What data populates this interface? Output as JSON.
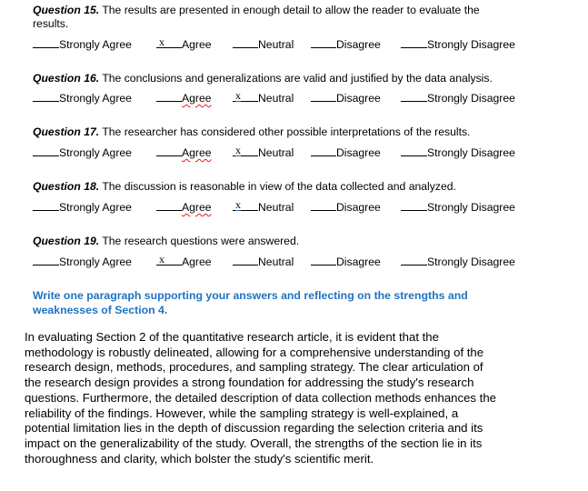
{
  "questions": [
    {
      "number": "Question 15.",
      "text_line1": " The results are presented in enough detail to allow the reader to evaluate the",
      "text_line2": "results.",
      "selected": "Agree",
      "options": [
        {
          "label": "Strongly Agree",
          "mark": "",
          "spell_flag": false
        },
        {
          "label": "Agree",
          "mark": "x",
          "spell_flag": false
        },
        {
          "label": "Neutral",
          "mark": "",
          "spell_flag": false
        },
        {
          "label": "Disagree",
          "mark": "",
          "spell_flag": false
        },
        {
          "label": "Strongly Disagree",
          "mark": "",
          "spell_flag": false
        }
      ]
    },
    {
      "number": "Question 16.",
      "text_line1": "  The conclusions and generalizations are valid and justified by the data analysis.",
      "text_line2": "",
      "selected": "Neutral",
      "options": [
        {
          "label": "Strongly Agree",
          "mark": "",
          "spell_flag": false
        },
        {
          "label": "Agree",
          "mark": "",
          "spell_flag": true
        },
        {
          "label": "Neutral",
          "mark": "x",
          "spell_flag": false
        },
        {
          "label": "Disagree",
          "mark": "",
          "spell_flag": false
        },
        {
          "label": "Strongly Disagree",
          "mark": "",
          "spell_flag": false
        }
      ]
    },
    {
      "number": "Question 17.",
      "text_line1": "  The researcher has considered other possible interpretations of the results.",
      "text_line2": "",
      "selected": "Neutral",
      "options": [
        {
          "label": "Strongly Agree",
          "mark": "",
          "spell_flag": false
        },
        {
          "label": "Agree",
          "mark": "",
          "spell_flag": true
        },
        {
          "label": "Neutral",
          "mark": "x",
          "spell_flag": false
        },
        {
          "label": "Disagree",
          "mark": "",
          "spell_flag": false
        },
        {
          "label": "Strongly Disagree",
          "mark": "",
          "spell_flag": false
        }
      ]
    },
    {
      "number": "Question 18.",
      "text_line1": "  The discussion is reasonable in view of the data collected and analyzed.",
      "text_line2": "",
      "selected": "Neutral",
      "options": [
        {
          "label": "Strongly Agree",
          "mark": "",
          "spell_flag": false
        },
        {
          "label": "Agree",
          "mark": "",
          "spell_flag": true
        },
        {
          "label": "Neutral",
          "mark": "x",
          "spell_flag": false
        },
        {
          "label": "Disagree",
          "mark": "",
          "spell_flag": false
        },
        {
          "label": "Strongly Disagree",
          "mark": "",
          "spell_flag": false
        }
      ]
    },
    {
      "number": "Question 19.",
      "text_line1": " The research questions were answered.",
      "text_line2": "",
      "selected": "Agree",
      "options": [
        {
          "label": "Strongly Agree",
          "mark": "",
          "spell_flag": false
        },
        {
          "label": "Agree",
          "mark": "x",
          "spell_flag": false
        },
        {
          "label": "Neutral",
          "mark": "",
          "spell_flag": false
        },
        {
          "label": "Disagree",
          "mark": "",
          "spell_flag": false
        },
        {
          "label": "Strongly Disagree",
          "mark": "",
          "spell_flag": false
        }
      ]
    }
  ],
  "prompt": {
    "line1": "Write one paragraph supporting your answers and reflecting on the strengths and",
    "line2": "weaknesses of Section 4.",
    "color": "#1f73c2"
  },
  "answer": {
    "lines": [
      "In evaluating Section 2 of the quantitative research article, it is evident that the",
      "methodology is robustly delineated, allowing for a comprehensive understanding of the",
      "research design, methods, procedures, and sampling strategy. The clear articulation of",
      "the research design provides a strong foundation for addressing the study's research",
      "questions. Furthermore, the detailed description of data collection methods enhances the",
      "reliability of the findings. However, while the sampling strategy is well-explained, a",
      "potential limitation lies in the depth of discussion regarding the selection criteria and its",
      "impact on the generalizability of the study. Overall, the strengths of the section lie in its",
      "thoroughness and clarity, which bolster the study's scientific merit."
    ]
  }
}
